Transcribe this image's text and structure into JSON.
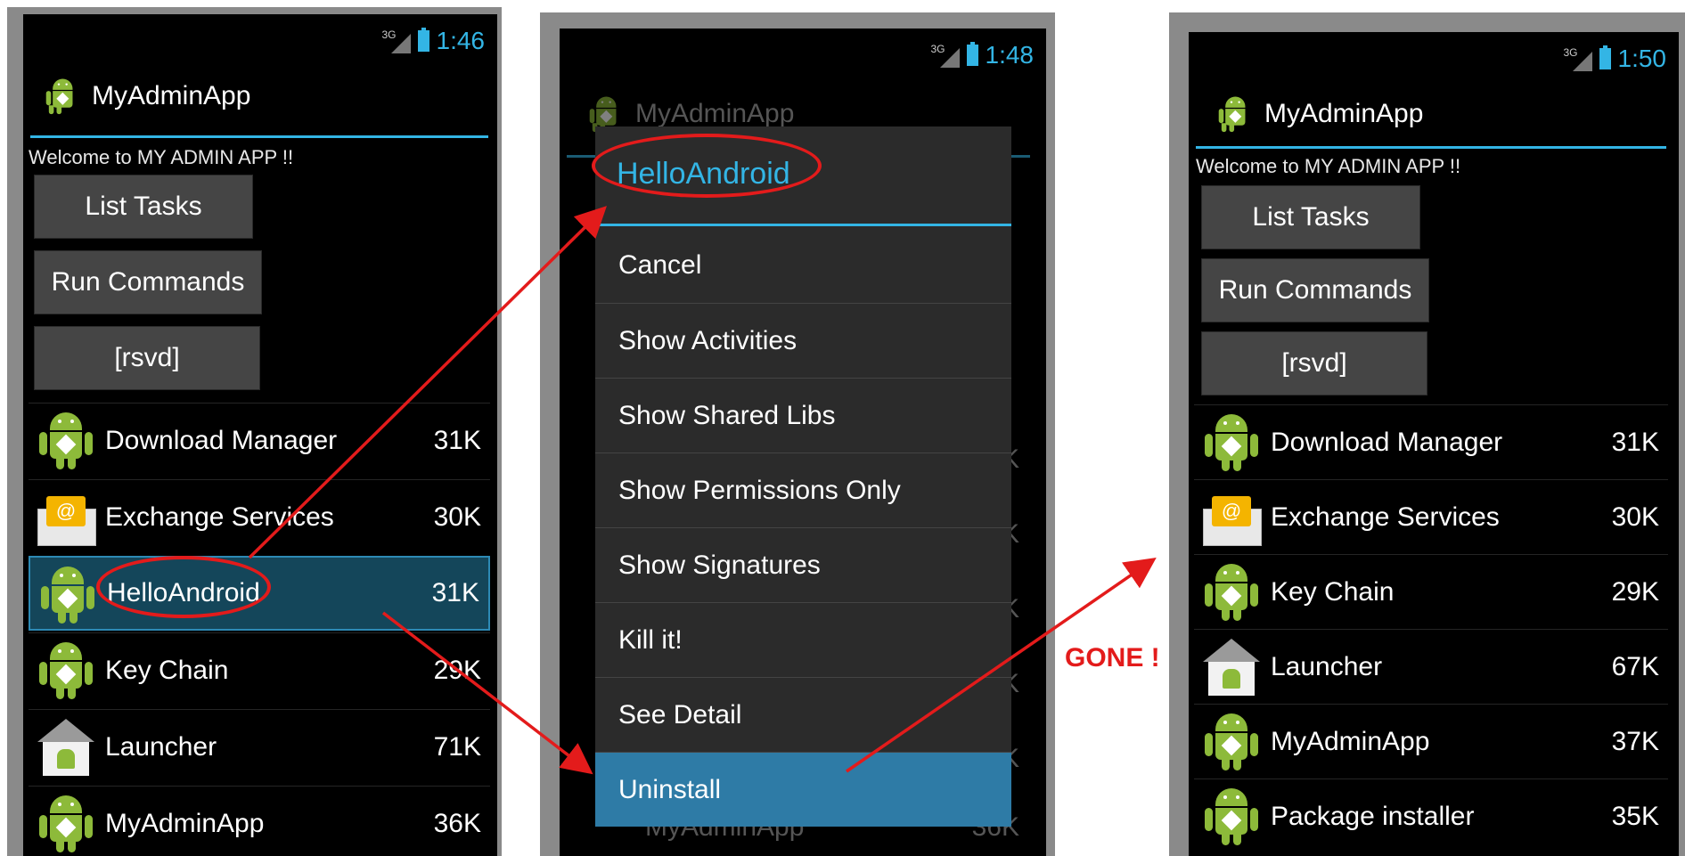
{
  "panel1": {
    "status": {
      "net": "3G",
      "time": "1:46"
    },
    "app_title": "MyAdminApp",
    "welcome": "Welcome to MY ADMIN APP !!",
    "buttons": [
      "List Tasks",
      "Run Commands",
      "[rsvd]"
    ],
    "apps": [
      {
        "name": "Download Manager",
        "size": "31K",
        "icon": "android-icon"
      },
      {
        "name": "Exchange Services",
        "size": "30K",
        "icon": "mail-icon"
      },
      {
        "name": "HelloAndroid",
        "size": "31K",
        "icon": "android-icon"
      },
      {
        "name": "Key Chain",
        "size": "29K",
        "icon": "android-icon"
      },
      {
        "name": "Launcher",
        "size": "71K",
        "icon": "launcher-icon"
      },
      {
        "name": "MyAdminApp",
        "size": "36K",
        "icon": "android-icon"
      }
    ]
  },
  "panel2": {
    "status": {
      "net": "3G",
      "time": "1:48"
    },
    "bg_title": "MyAdminApp",
    "dialog_title": "HelloAndroid",
    "items": [
      "Cancel",
      "Show Activities",
      "Show Shared Libs",
      "Show Permissions Only",
      "Show Signatures",
      "Kill it!",
      "See Detail",
      "Uninstall"
    ],
    "bg_bottom_name": "MyAdminApp",
    "bg_bottom_size": "36K",
    "bg_sizes": [
      "K",
      "K",
      "K",
      "K",
      "K"
    ]
  },
  "panel3": {
    "status": {
      "net": "3G",
      "time": "1:50"
    },
    "app_title": "MyAdminApp",
    "welcome": "Welcome to MY ADMIN APP !!",
    "buttons": [
      "List Tasks",
      "Run Commands",
      "[rsvd]"
    ],
    "apps": [
      {
        "name": "Download Manager",
        "size": "31K",
        "icon": "android-icon"
      },
      {
        "name": "Exchange Services",
        "size": "30K",
        "icon": "mail-icon"
      },
      {
        "name": "Key Chain",
        "size": "29K",
        "icon": "android-icon"
      },
      {
        "name": "Launcher",
        "size": "67K",
        "icon": "launcher-icon"
      },
      {
        "name": "MyAdminApp",
        "size": "37K",
        "icon": "android-icon"
      },
      {
        "name": "Package installer",
        "size": "35K",
        "icon": "android-icon"
      }
    ]
  },
  "annotation": {
    "gone_label": "GONE !",
    "color": "#e31b1b"
  },
  "accent": "#33b5e5"
}
